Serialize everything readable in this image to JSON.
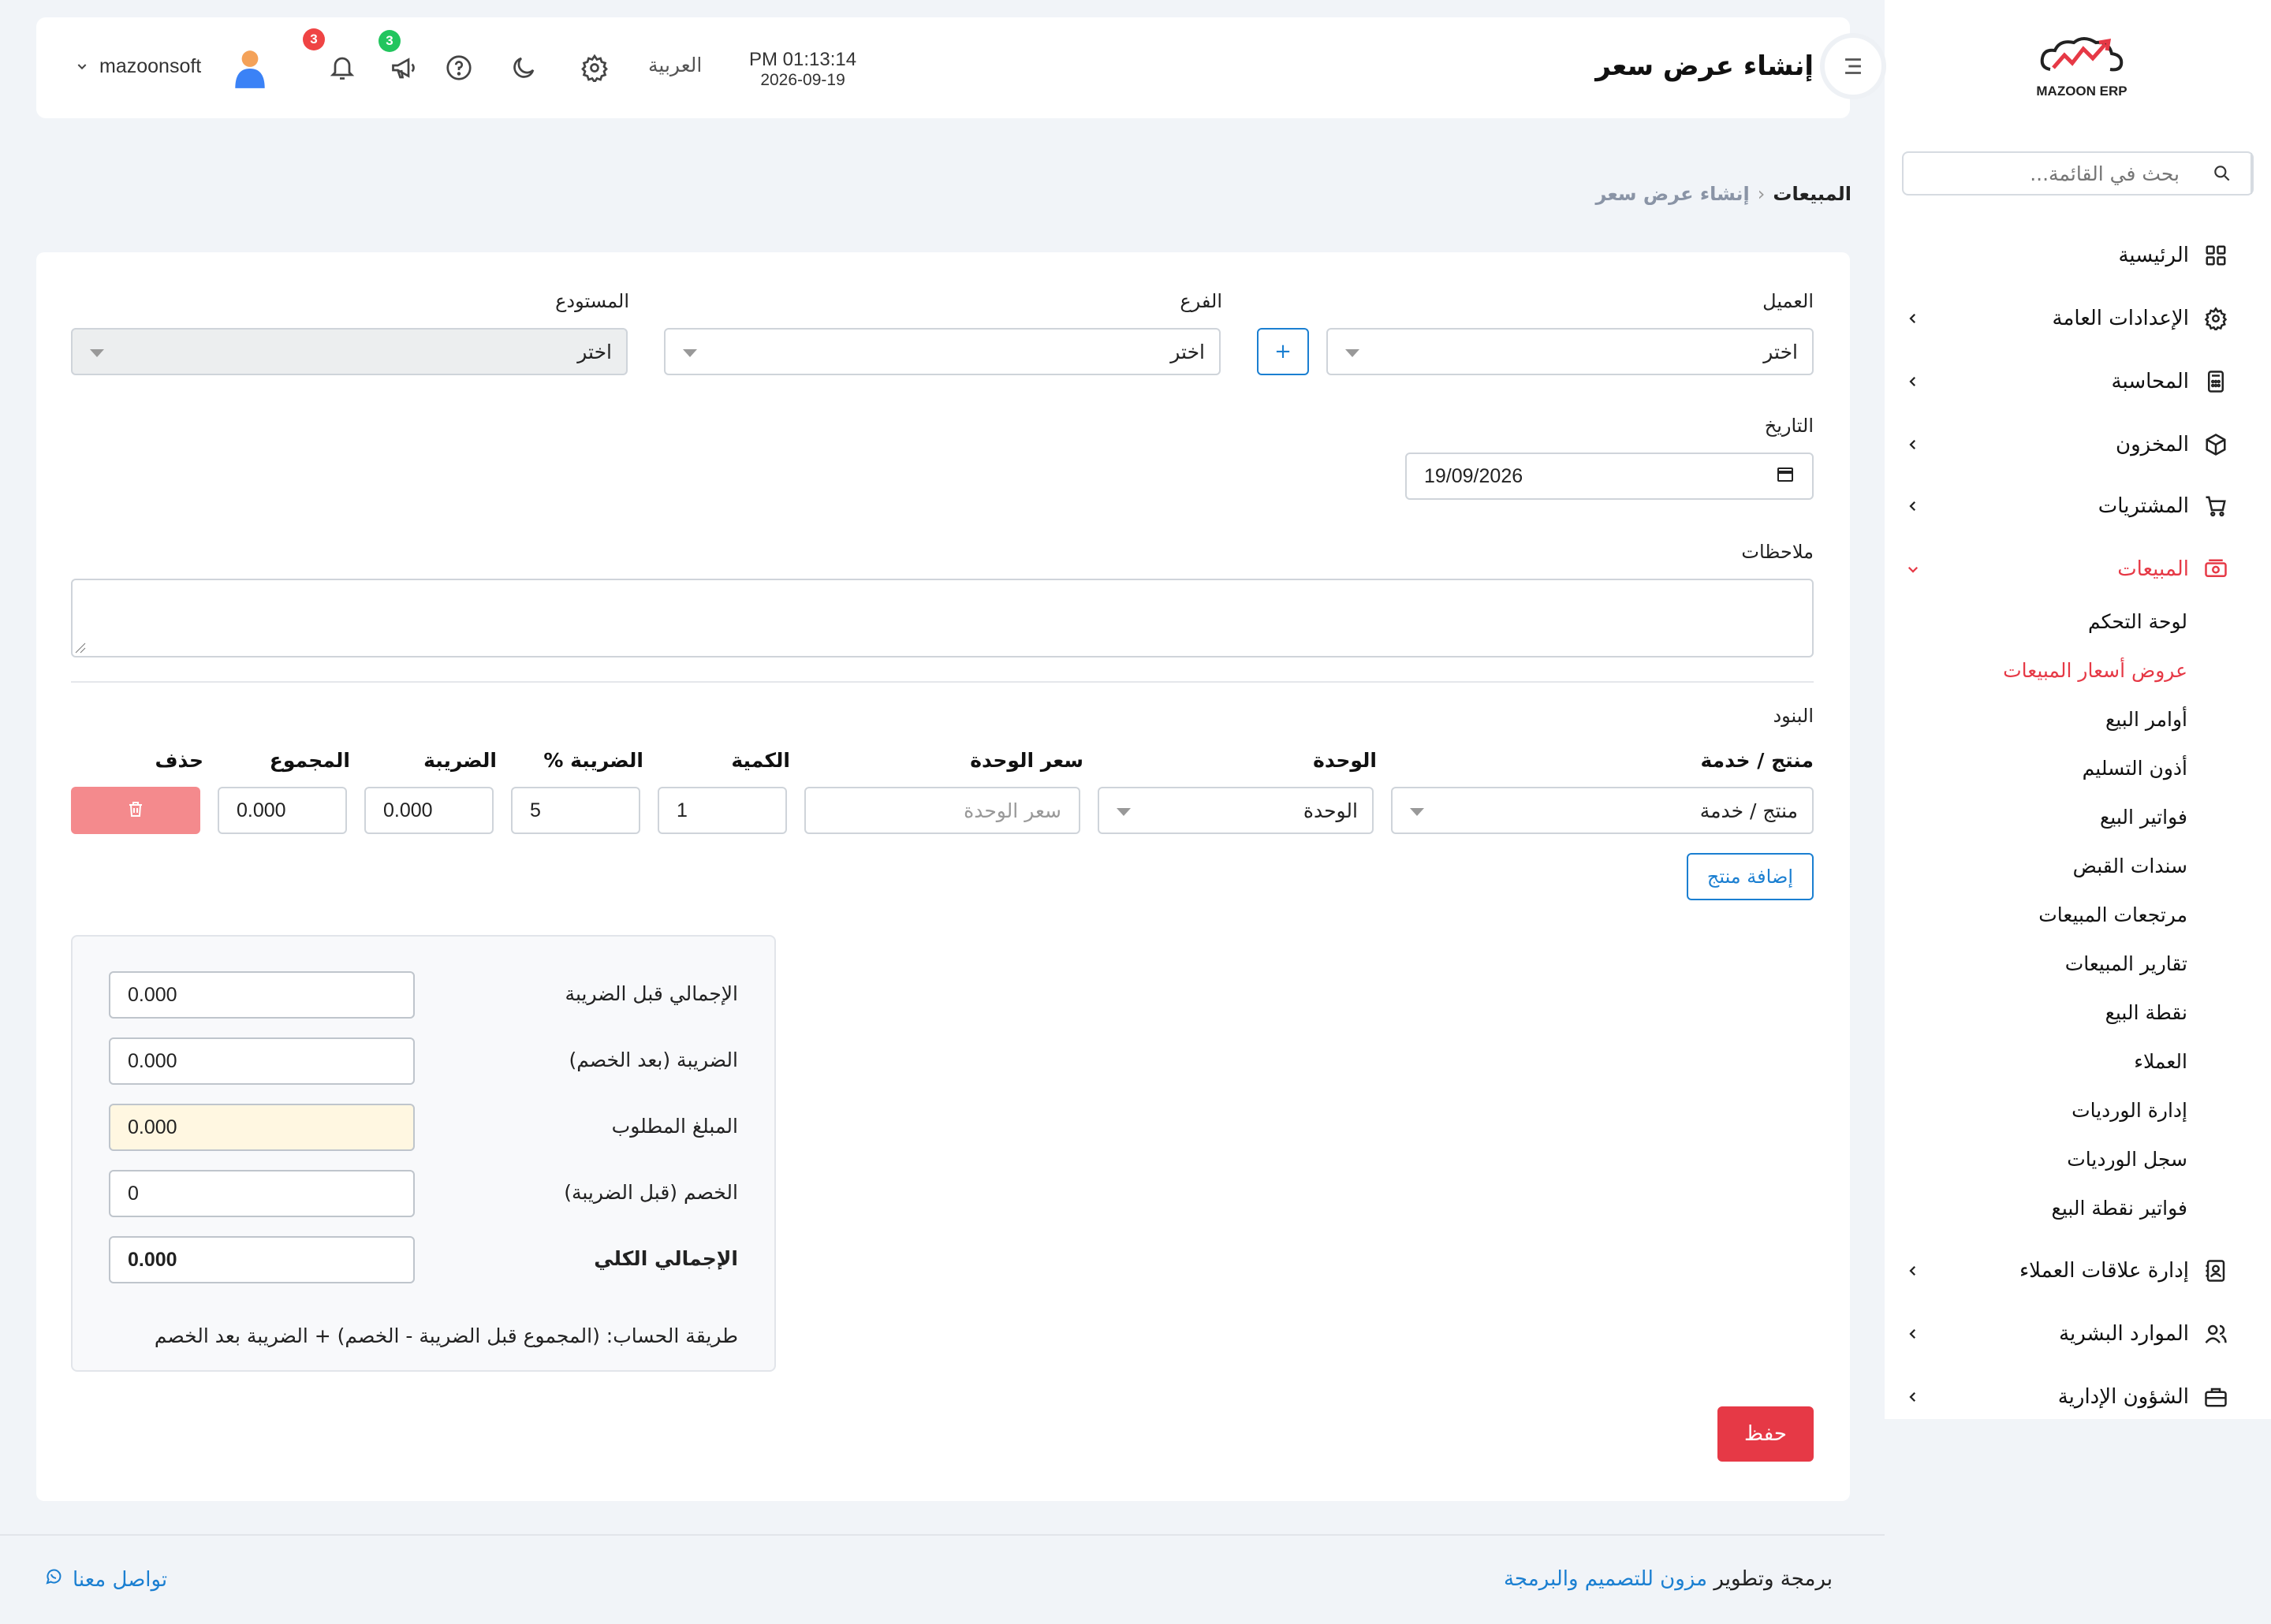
{
  "app": {
    "logo_text": "MAZOON ERP"
  },
  "sidebar": {
    "search_placeholder": "بحث في القائمة...",
    "items": [
      {
        "label": "الرئيسية",
        "icon": "grid-icon"
      },
      {
        "label": "الإعدادات العامة",
        "icon": "gear-icon"
      },
      {
        "label": "المحاسبة",
        "icon": "calculator-icon"
      },
      {
        "label": "المخزون",
        "icon": "box-icon"
      },
      {
        "label": "المشتريات",
        "icon": "cart-icon"
      },
      {
        "label": "المبيعات",
        "icon": "cash-icon"
      },
      {
        "label": "إدارة علاقات العملاء",
        "icon": "contacts-icon"
      },
      {
        "label": "الموارد البشرية",
        "icon": "users-icon"
      },
      {
        "label": "الشؤون الإدارية",
        "icon": "briefcase-icon"
      }
    ],
    "sales_sub": [
      "لوحة التحكم",
      "عروض أسعار المبيعات",
      "أوامر البيع",
      "أذون التسليم",
      "فواتير البيع",
      "سندات القبض",
      "مرتجعات المبيعات",
      "تقارير المبيعات",
      "نقطة البيع",
      "العملاء",
      "إدارة الورديات",
      "سجل الورديات",
      "فواتير نقطة البيع"
    ]
  },
  "header": {
    "title": "إنشاء عرض سعر",
    "time": "PM 01:13:14",
    "date": "2026-09-19",
    "language": "العربية",
    "announcements_count": "3",
    "notifications_count": "3",
    "username": "mazoonsoft"
  },
  "breadcrumb": {
    "parent": "المبيعات",
    "current": "إنشاء عرض سعر"
  },
  "form": {
    "customer_label": "العميل",
    "customer_value": "اختر",
    "add_customer": "+",
    "branch_label": "الفرع",
    "branch_value": "اختر",
    "warehouse_label": "المستودع",
    "warehouse_value": "اختر",
    "date_label": "التاريخ",
    "date_value": "19/09/2026",
    "notes_label": "ملاحظات",
    "notes_value": ""
  },
  "items": {
    "section_label": "البنود",
    "headers": {
      "product": "منتج / خدمة",
      "unit": "الوحدة",
      "price": "سعر الوحدة",
      "qty": "الكمية",
      "tax_pct": "الضريبة %",
      "tax": "الضريبة",
      "total": "المجموع",
      "delete": "حذف"
    },
    "row": {
      "product": "منتج / خدمة",
      "unit": "الوحدة",
      "price_placeholder": "سعر الوحدة",
      "qty": "1",
      "tax_pct": "5",
      "tax": "0.000",
      "total": "0.000"
    },
    "add_button": "إضافة منتج"
  },
  "summary": {
    "subtotal_label": "الإجمالي قبل الضريبة",
    "subtotal": "0.000",
    "tax_label": "الضريبة (بعد الخصم)",
    "tax": "0.000",
    "due_label": "المبلغ المطلوب",
    "due": "0.000",
    "discount_label": "الخصم (قبل الضريبة)",
    "discount": "0",
    "grand_label": "الإجمالي الكلي",
    "grand": "0.000",
    "formula": "طريقة الحساب: (المجموع قبل الضريبة - الخصم) + الضريبة بعد الخصم"
  },
  "save_button": "حفظ",
  "footer": {
    "prefix": "برمجة وتطوير",
    "company": "مزون للتصميم والبرمجة",
    "contact": "تواصل معنا"
  },
  "colors": {
    "accent": "#e63946",
    "link": "#1b7fd1",
    "badge_red": "#ef4444",
    "badge_green": "#22c55e"
  }
}
